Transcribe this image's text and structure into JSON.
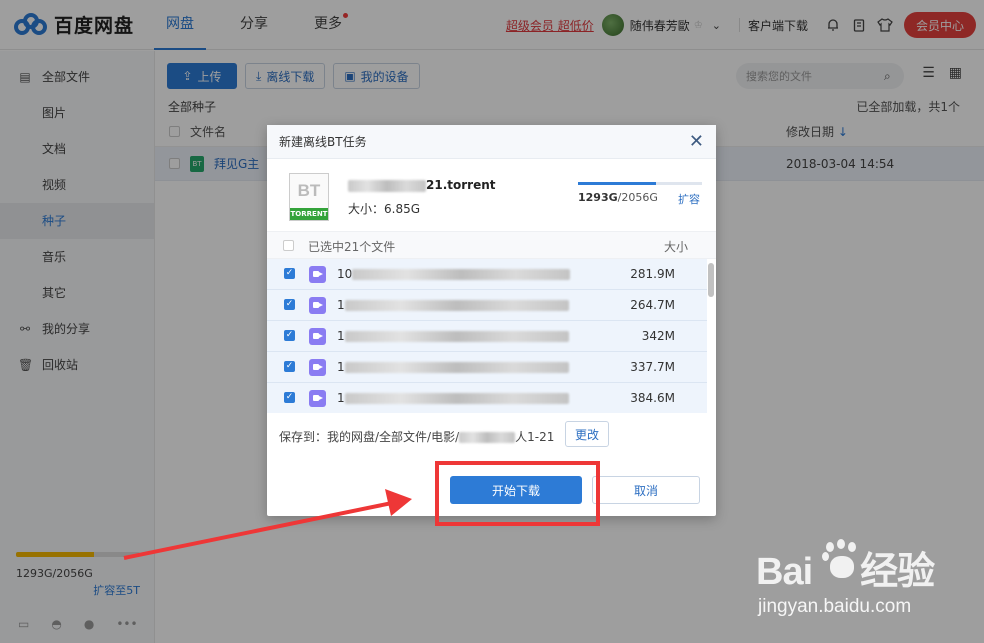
{
  "app": {
    "logo_text": "百度网盘"
  },
  "nav": {
    "tabs": [
      {
        "label": "网盘",
        "active": true
      },
      {
        "label": "分享",
        "active": false
      },
      {
        "label": "更多",
        "active": false,
        "badge_dot": true
      }
    ]
  },
  "header": {
    "vip_link": "超级会员 超低价",
    "username": "随伟春芳歐",
    "client_download": "客户端下载",
    "member_center": "会员中心",
    "icons": [
      "bell-icon",
      "clipboard-icon",
      "shirt-icon"
    ]
  },
  "sidebar": {
    "items": [
      {
        "label": "全部文件",
        "icon": "file-icon",
        "sub": false,
        "active": false
      },
      {
        "label": "图片",
        "sub": true,
        "active": false
      },
      {
        "label": "文档",
        "sub": true,
        "active": false
      },
      {
        "label": "视频",
        "sub": true,
        "active": false
      },
      {
        "label": "种子",
        "sub": true,
        "active": true
      },
      {
        "label": "音乐",
        "sub": true,
        "active": false
      },
      {
        "label": "其它",
        "sub": true,
        "active": false
      },
      {
        "label": "我的分享",
        "icon": "share-icon",
        "sub": false,
        "active": false
      },
      {
        "label": "回收站",
        "icon": "trash-icon",
        "sub": false,
        "active": false
      }
    ],
    "quota": {
      "used": "1293G",
      "total": "2056G",
      "text": "1293G/2056G",
      "fraction": 0.63,
      "expand_link": "扩容至5T"
    },
    "platforms": [
      "desktop-icon",
      "android-icon",
      "apple-icon",
      "more-icon"
    ]
  },
  "toolbar": {
    "upload_label": "上传",
    "offline_label": "离线下载",
    "devices_label": "我的设备",
    "search_placeholder": "搜索您的文件"
  },
  "file_list": {
    "breadcrumb": "全部种子",
    "loaded_status": "已全部加载，共1个",
    "col_name": "文件名",
    "col_date": "修改日期",
    "rows": [
      {
        "name": "拜见G主",
        "date": "2018-03-04 14:54"
      }
    ]
  },
  "dialog": {
    "title": "新建离线BT任务",
    "torrent_name_suffix": "21.torrent",
    "torrent_size": "大小：6.85G",
    "quota_used": "1293G",
    "quota_total": "/2056G",
    "quota_fraction": 0.63,
    "expand_label": "扩容",
    "selected_label": "已选中21个文件",
    "size_header": "大小",
    "files": [
      {
        "prefix": "10",
        "size": "281.9M"
      },
      {
        "prefix": "1",
        "size": "264.7M"
      },
      {
        "prefix": "1",
        "size": "342M"
      },
      {
        "prefix": "1",
        "size": "337.7M"
      },
      {
        "prefix": "1",
        "size": "384.6M"
      }
    ],
    "save_to_prefix": "保存到：我的网盘/全部文件/电影/",
    "save_to_suffix": "人1-21",
    "change_label": "更改",
    "start_label": "开始下载",
    "cancel_label": "取消"
  },
  "watermark": {
    "url": "jingyan.baidu.com"
  },
  "colors": {
    "accent": "#2d7bd6",
    "vip_red": "#e6413e",
    "quota_yellow": "#f5b800",
    "annotation_red": "#ee3737"
  }
}
